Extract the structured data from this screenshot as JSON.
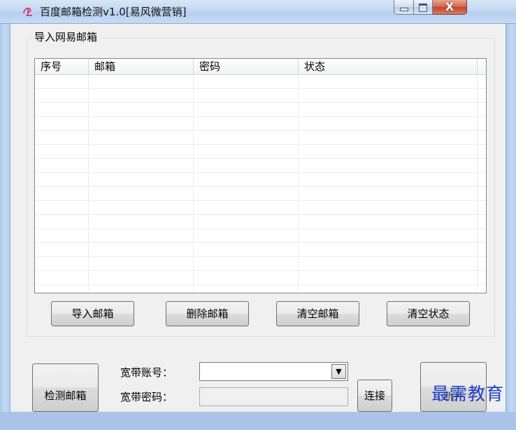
{
  "window": {
    "title": "百度邮箱检测v1.0[易风微营销]",
    "close_glyph": "X"
  },
  "group": {
    "label": "导入网易邮箱"
  },
  "list": {
    "columns": [
      "序号",
      "邮箱",
      "密码",
      "状态"
    ],
    "rows": []
  },
  "buttons": {
    "import": "导入邮箱",
    "delete": "删除邮箱",
    "clear_mail": "清空邮箱",
    "clear_status": "清空状态",
    "detect": "检测邮箱",
    "connect": "连接",
    "right": "断开"
  },
  "broadband": {
    "account_label": "宽带账号：",
    "password_label": "宽带密码：",
    "account_value": "",
    "password_value": ""
  },
  "watermark": "最需教育",
  "icons": {
    "app": "app-logo-icon",
    "dropdown": "dropdown-arrow-icon"
  }
}
